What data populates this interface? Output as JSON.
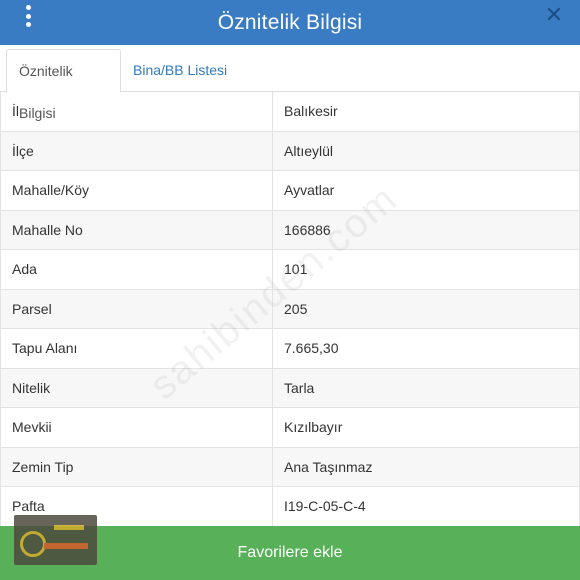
{
  "header": {
    "title": "Öznitelik Bilgisi",
    "menu_icon": "kebab-menu-icon",
    "close_icon": "close-icon"
  },
  "tabs": [
    {
      "label": "Öznitelik Bilgisi",
      "active": true
    },
    {
      "label": "Bina/BB Listesi",
      "active": false
    }
  ],
  "rows": [
    {
      "key": "İl",
      "value": "Balıkesir"
    },
    {
      "key": "İlçe",
      "value": "Altıeylül"
    },
    {
      "key": "Mahalle/Köy",
      "value": "Ayvatlar"
    },
    {
      "key": "Mahalle No",
      "value": "166886"
    },
    {
      "key": "Ada",
      "value": "101"
    },
    {
      "key": "Parsel",
      "value": "205"
    },
    {
      "key": "Tapu Alanı",
      "value": "7.665,30"
    },
    {
      "key": "Nitelik",
      "value": "Tarla"
    },
    {
      "key": "Mevkii",
      "value": "Kızılbayır"
    },
    {
      "key": "Zemin Tip",
      "value": "Ana Taşınmaz"
    },
    {
      "key": "Pafta",
      "value": "I19-C-05-C-4"
    }
  ],
  "watermark": "sahibinden.com",
  "footer": {
    "button_label": "Favorilere ekle"
  },
  "colors": {
    "header": "#3a7cc4",
    "button": "#58b159",
    "link": "#337ab7"
  }
}
